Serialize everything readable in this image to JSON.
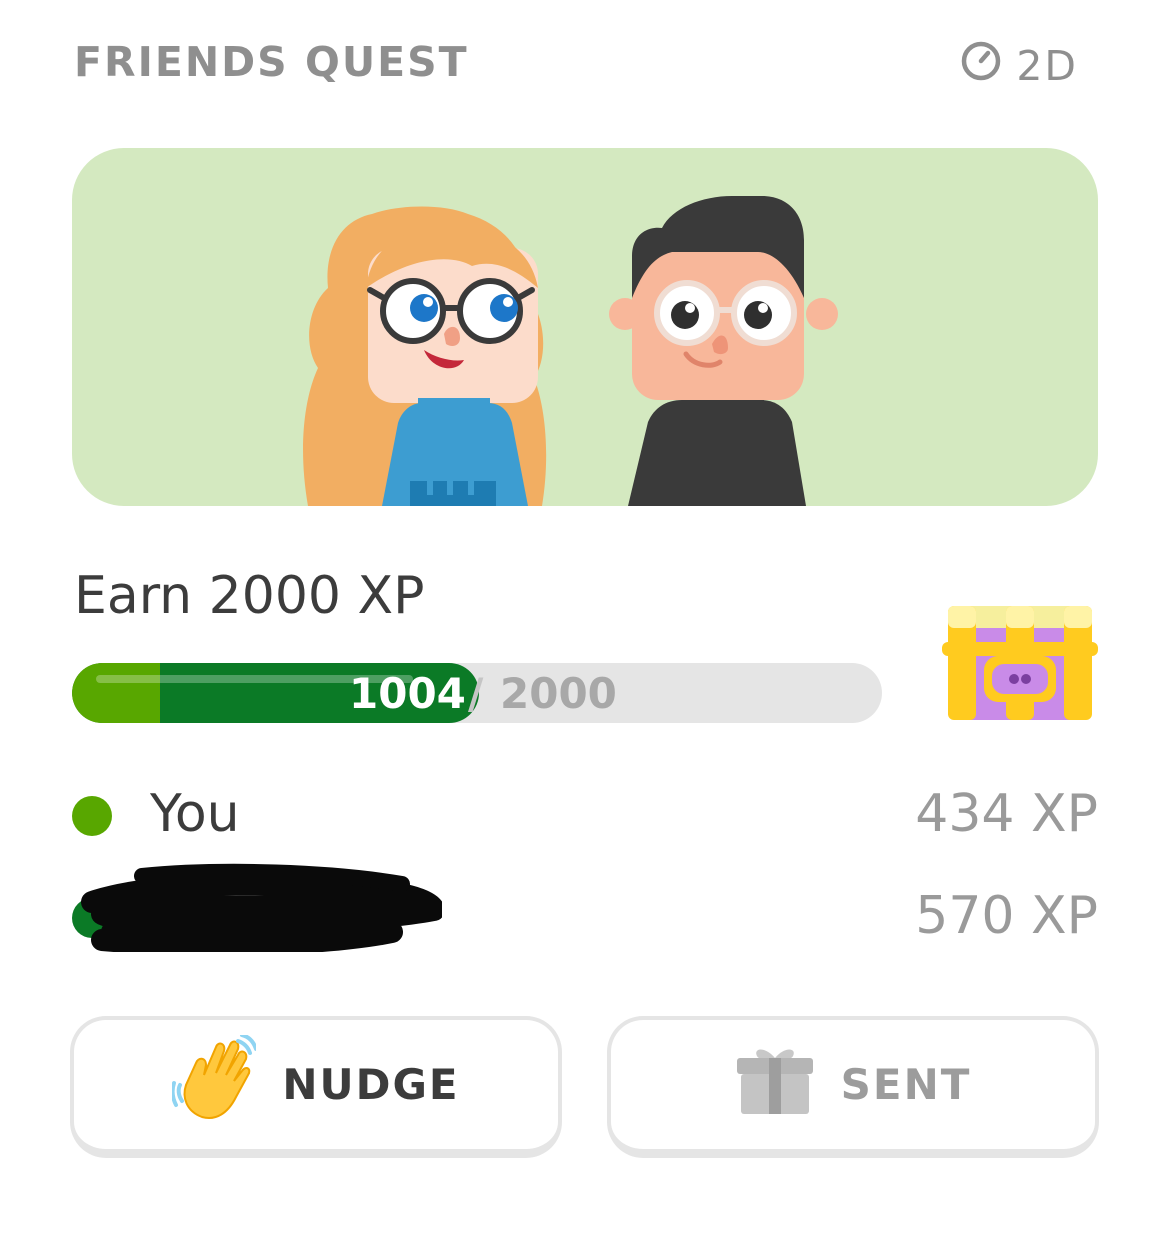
{
  "header": {
    "title": "FRIENDS QUEST",
    "time_left": "2D",
    "timer_icon": "timer-icon"
  },
  "banner": {
    "background": "#d4e9c0",
    "characters": [
      "woman-glasses-avatar",
      "man-glasses-avatar"
    ]
  },
  "quest": {
    "goal": "Earn 2000 XP",
    "progress_current": "1004",
    "progress_separator": "/",
    "progress_total": "2000",
    "progress_fraction": 0.502,
    "reward_icon": "treasure-chest-icon"
  },
  "members": [
    {
      "name": "You",
      "xp": "434 XP",
      "dot_color": "#58a700"
    },
    {
      "name": "",
      "xp": "570 XP",
      "dot_color": "#0b7a26",
      "redacted": true
    }
  ],
  "actions": {
    "nudge_label": "NUDGE",
    "nudge_icon": "waving-hand-icon",
    "sent_label": "SENT",
    "sent_icon": "gift-icon"
  },
  "colors": {
    "progress_light": "#58a700",
    "progress_dark": "#0b7a26",
    "text_gray": "#8f8f8f"
  }
}
